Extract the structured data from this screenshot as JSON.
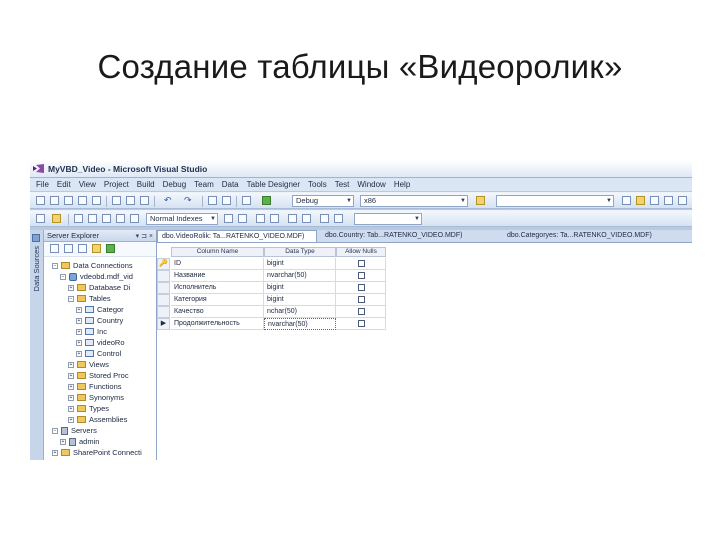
{
  "slide": {
    "title": "Создание таблицы «Видеоролик»"
  },
  "window": {
    "title": "MyVBD_Video - Microsoft Visual Studio"
  },
  "menu": [
    "File",
    "Edit",
    "View",
    "Project",
    "Build",
    "Debug",
    "Team",
    "Data",
    "Table Designer",
    "Tools",
    "Test",
    "Window",
    "Help"
  ],
  "toolbar1": {
    "config": "Debug",
    "platform": "x86"
  },
  "toolbar2": {
    "view_combo": "Normal Indexes"
  },
  "side_tab": {
    "label": "Data Sources"
  },
  "explorer": {
    "title": "Server Explorer",
    "controls": "▾ ⊐ ×",
    "items": [
      {
        "label": "Data Connections",
        "expander": "−",
        "icon": "folder-icon"
      },
      {
        "label": "vdeobd.mdf_vid",
        "expander": "−",
        "icon": "database-icon"
      },
      {
        "label": "Database Di",
        "expander": "+",
        "icon": "folder-icon"
      },
      {
        "label": "Tables",
        "expander": "−",
        "icon": "folder-icon"
      },
      {
        "label": "Categor",
        "expander": "+",
        "icon": "table-icon"
      },
      {
        "label": "Country",
        "expander": "+",
        "icon": "table-icon"
      },
      {
        "label": "Inc",
        "expander": "+",
        "icon": "table-icon"
      },
      {
        "label": "videoRo",
        "expander": "+",
        "icon": "table-icon"
      },
      {
        "label": "Control",
        "expander": "+",
        "icon": "table-icon"
      },
      {
        "label": "Views",
        "expander": "+",
        "icon": "folder-icon"
      },
      {
        "label": "Stored Proc",
        "expander": "+",
        "icon": "folder-icon"
      },
      {
        "label": "Functions",
        "expander": "+",
        "icon": "folder-icon"
      },
      {
        "label": "Synonyms",
        "expander": "+",
        "icon": "folder-icon"
      },
      {
        "label": "Types",
        "expander": "+",
        "icon": "folder-icon"
      },
      {
        "label": "Assemblies",
        "expander": "+",
        "icon": "folder-icon"
      },
      {
        "label": "Servers",
        "expander": "−",
        "icon": "server-icon"
      },
      {
        "label": "admin",
        "expander": "+",
        "icon": "server-icon"
      },
      {
        "label": "SharePoint Connecti",
        "expander": "+",
        "icon": "folder-icon"
      }
    ]
  },
  "tabs": [
    {
      "label": "dbo.VideoRolik: Ta...RATENKO_VIDEO.MDF)",
      "active": true
    },
    {
      "label": "dbo.Country: Tab...RATENKO_VIDEO.MDF)",
      "active": false
    },
    {
      "label": "dbo.Categoryes: Ta...RATENKO_VIDEO.MDF)",
      "active": false
    }
  ],
  "grid": {
    "headers": [
      "Column Name",
      "Data Type",
      "Allow Nulls"
    ],
    "rows": [
      {
        "name": "ID",
        "type": "bigint",
        "allow_nulls": false,
        "key": true
      },
      {
        "name": "Название",
        "type": "nvarchar(50)",
        "allow_nulls": false,
        "key": false
      },
      {
        "name": "Исполнитель",
        "type": "bigint",
        "allow_nulls": false,
        "key": false
      },
      {
        "name": "Категория",
        "type": "bigint",
        "allow_nulls": false,
        "key": false
      },
      {
        "name": "Качество",
        "type": "nchar(50)",
        "allow_nulls": false,
        "key": false
      },
      {
        "name": "Продолжительность",
        "type": "nvarchar(50)",
        "allow_nulls": false,
        "key": false,
        "selected": true
      }
    ]
  }
}
